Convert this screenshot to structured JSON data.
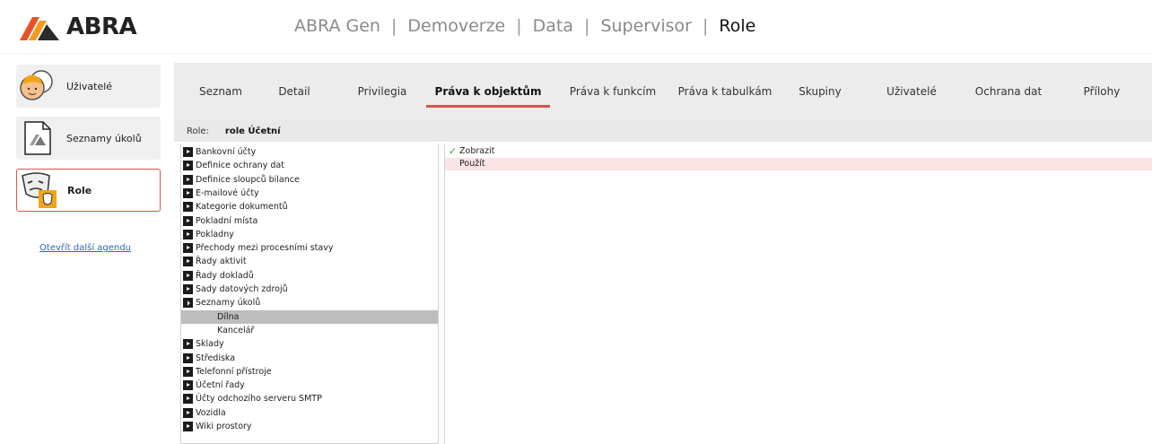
{
  "header": {
    "logo_text": "ABRA",
    "breadcrumbs": [
      "ABRA Gen",
      "Demoverze",
      "Data",
      "Supervisor",
      "Role"
    ],
    "separator": "|"
  },
  "agenda": {
    "items": [
      {
        "label": "Uživatelé",
        "icon": "users-icon",
        "active": false
      },
      {
        "label": "Seznamy úkolů",
        "icon": "document-icon",
        "active": false
      },
      {
        "label": "Role",
        "icon": "theater-masks-icon",
        "active": true
      }
    ],
    "more_link": "Otevřít další agendu"
  },
  "tabs": [
    {
      "label": "Seznam",
      "active": false
    },
    {
      "label": "Detail",
      "active": false
    },
    {
      "label": "Privilegia",
      "active": false
    },
    {
      "label": "Práva k objektům",
      "active": true
    },
    {
      "label": "Práva k funkcím",
      "active": false
    },
    {
      "label": "Práva k tabulkám",
      "active": false
    },
    {
      "label": "Skupiny",
      "active": false
    },
    {
      "label": "Uživatelé",
      "active": false
    },
    {
      "label": "Ochrana dat",
      "active": false
    },
    {
      "label": "Přílohy",
      "active": false
    }
  ],
  "role": {
    "key": "Role:",
    "value": "role Účetní"
  },
  "tree": [
    {
      "label": "Bankovní účty",
      "level": 0,
      "expanded": false
    },
    {
      "label": "Definice ochrany dat",
      "level": 0,
      "expanded": false
    },
    {
      "label": "Definice sloupců bilance",
      "level": 0,
      "expanded": false
    },
    {
      "label": "E-mailové účty",
      "level": 0,
      "expanded": false
    },
    {
      "label": "Kategorie dokumentů",
      "level": 0,
      "expanded": false
    },
    {
      "label": "Pokladní místa",
      "level": 0,
      "expanded": false
    },
    {
      "label": "Pokladny",
      "level": 0,
      "expanded": false
    },
    {
      "label": "Přechody mezi procesními stavy",
      "level": 0,
      "expanded": false
    },
    {
      "label": "Řady aktivit",
      "level": 0,
      "expanded": false
    },
    {
      "label": "Řady dokladů",
      "level": 0,
      "expanded": false
    },
    {
      "label": "Sady datových zdrojů",
      "level": 0,
      "expanded": false
    },
    {
      "label": "Seznamy úkolů",
      "level": 0,
      "expanded": true
    },
    {
      "label": "Dílna",
      "level": 1,
      "selected": true
    },
    {
      "label": "Kancelář",
      "level": 1
    },
    {
      "label": "Sklady",
      "level": 0,
      "expanded": false
    },
    {
      "label": "Střediska",
      "level": 0,
      "expanded": false
    },
    {
      "label": "Telefonní přístroje",
      "level": 0,
      "expanded": false
    },
    {
      "label": "Účetní řady",
      "level": 0,
      "expanded": false
    },
    {
      "label": "Účty odchozího serveru SMTP",
      "level": 0,
      "expanded": false
    },
    {
      "label": "Vozidla",
      "level": 0,
      "expanded": false
    },
    {
      "label": "Wiki prostory",
      "level": 0,
      "expanded": false
    }
  ],
  "rights": [
    {
      "label": "Zobrazit",
      "checked": true,
      "highlighted": false
    },
    {
      "label": "Použít",
      "checked": false,
      "highlighted": true
    }
  ],
  "colors": {
    "accent": "#d9534f",
    "tab_bar": "#ececec",
    "selection": "#bdbdbd",
    "highlight_row": "#fbe3e6",
    "check": "#3aa640",
    "link": "#2a66c8"
  }
}
